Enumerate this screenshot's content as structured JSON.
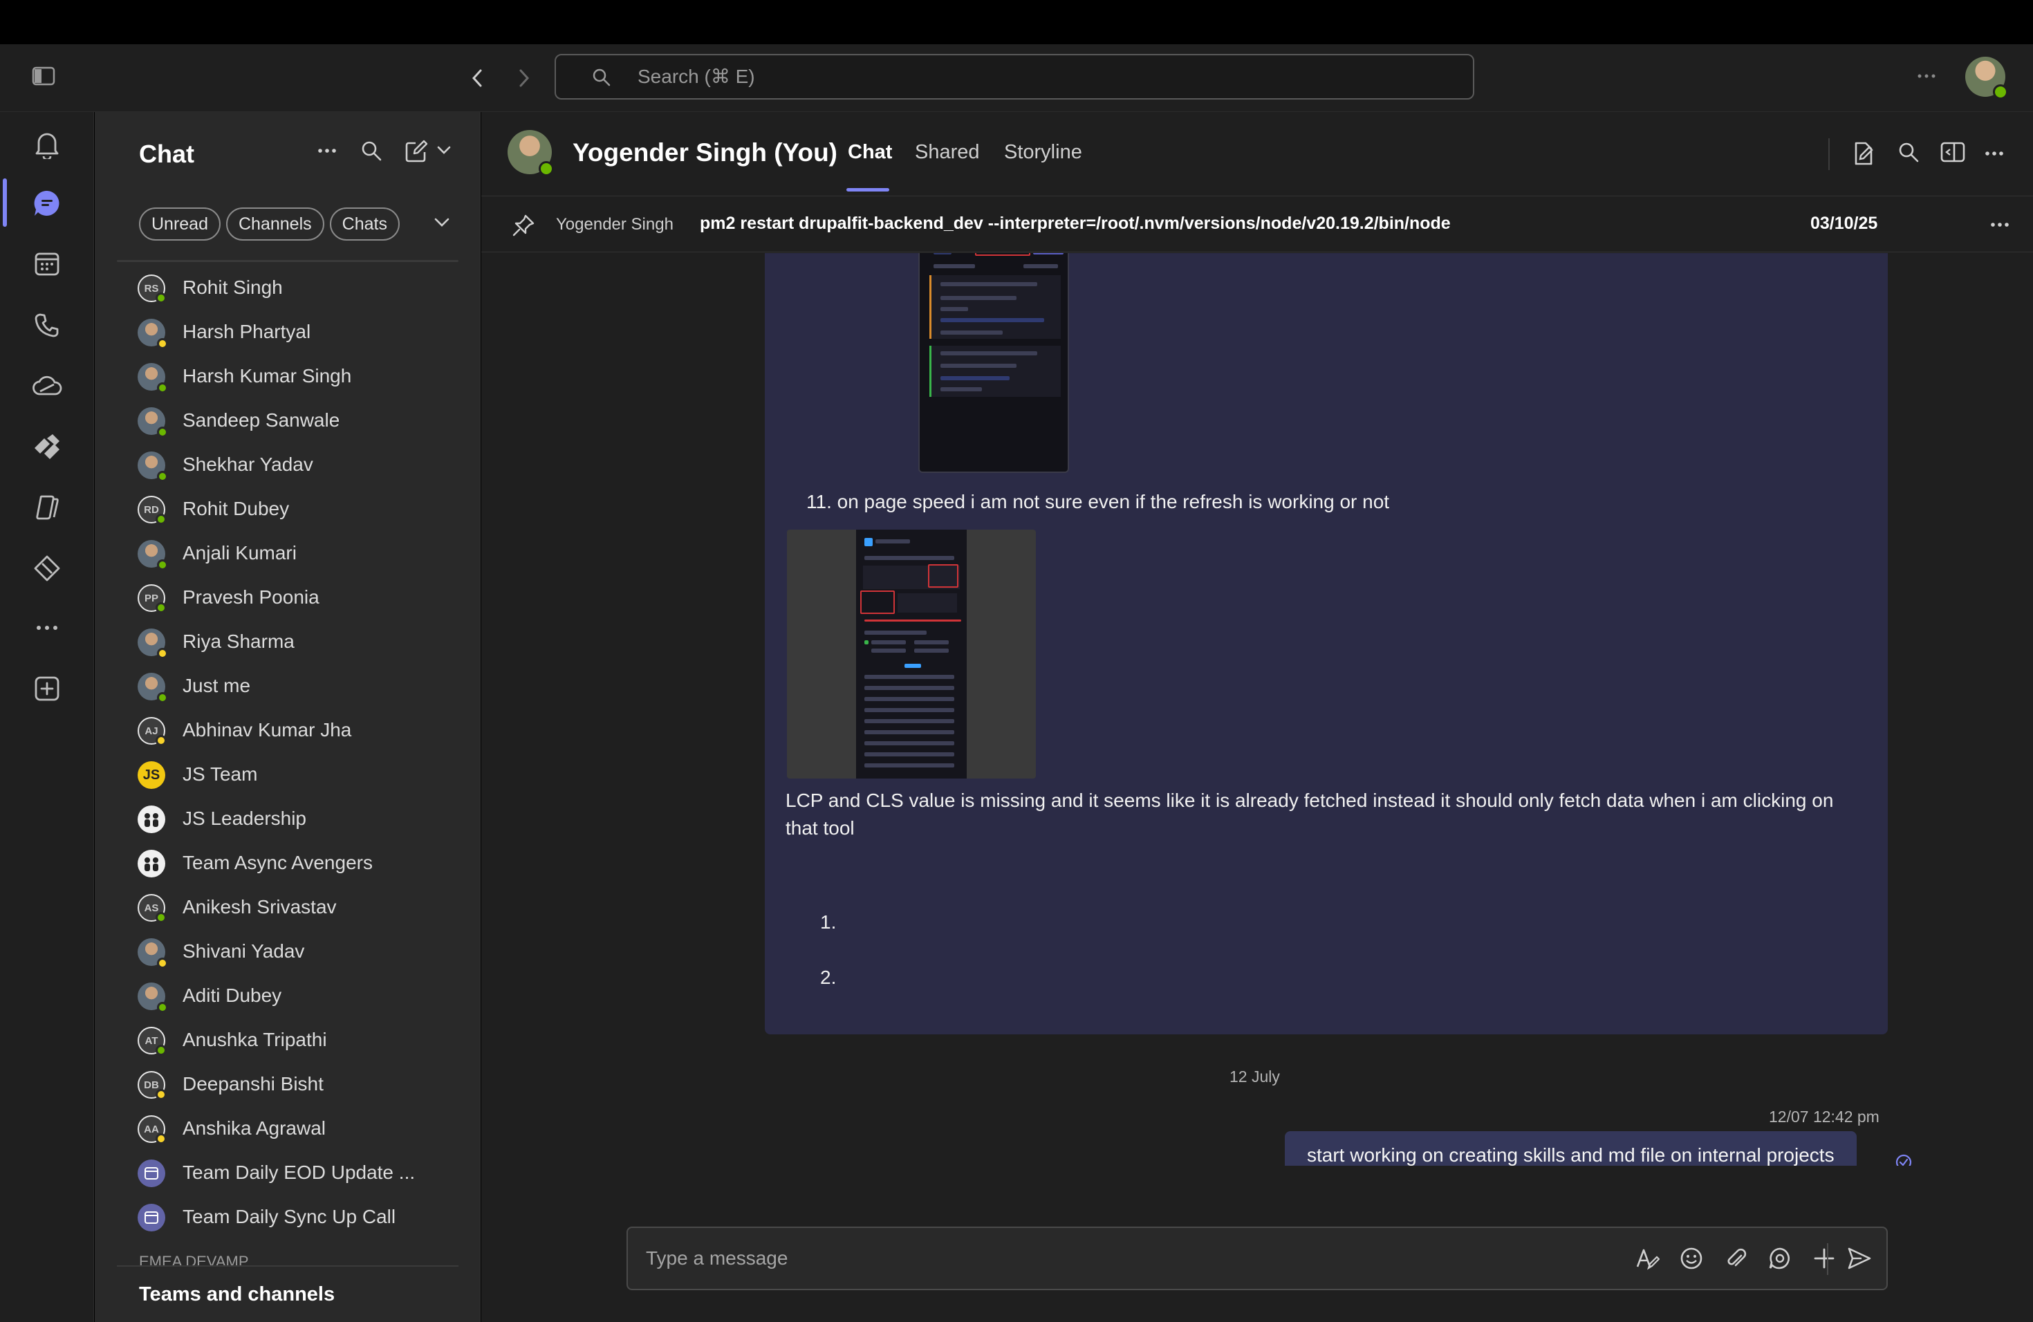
{
  "topbar": {
    "search_placeholder": "Search (⌘ E)"
  },
  "chat_panel": {
    "title": "Chat",
    "filters": [
      "Unread",
      "Channels",
      "Chats"
    ],
    "items": [
      {
        "name": "Rohit Singh",
        "initials": "RS",
        "avatar": "init",
        "status": "#6bb700"
      },
      {
        "name": "Harsh Phartyal",
        "initials": "",
        "avatar": "photo",
        "status": "#f8d22a"
      },
      {
        "name": "Harsh Kumar Singh",
        "initials": "",
        "avatar": "photo",
        "status": "#6bb700"
      },
      {
        "name": "Sandeep Sanwale",
        "initials": "",
        "avatar": "photo",
        "status": "#6bb700"
      },
      {
        "name": "Shekhar Yadav",
        "initials": "",
        "avatar": "photo",
        "status": "#6bb700"
      },
      {
        "name": "Rohit Dubey",
        "initials": "RD",
        "avatar": "init",
        "status": "#6bb700"
      },
      {
        "name": "Anjali Kumari",
        "initials": "",
        "avatar": "photo",
        "status": "#6bb700"
      },
      {
        "name": "Pravesh Poonia",
        "initials": "PP",
        "avatar": "init",
        "status": "#6bb700"
      },
      {
        "name": "Riya Sharma",
        "initials": "",
        "avatar": "photo",
        "status": "#f8d22a"
      },
      {
        "name": "Just me",
        "initials": "",
        "avatar": "photo",
        "status": "#6bb700"
      },
      {
        "name": "Abhinav Kumar Jha",
        "initials": "AJ",
        "avatar": "init",
        "status": "#f8d22a"
      },
      {
        "name": "JS Team",
        "initials": "JS",
        "avatar": "js",
        "status": ""
      },
      {
        "name": "JS Leadership",
        "initials": "",
        "avatar": "group",
        "status": ""
      },
      {
        "name": "Team Async Avengers",
        "initials": "",
        "avatar": "group",
        "status": ""
      },
      {
        "name": "Anikesh Srivastav",
        "initials": "AS",
        "avatar": "init",
        "status": "#6bb700"
      },
      {
        "name": "Shivani Yadav",
        "initials": "",
        "avatar": "photo",
        "status": "#f8d22a"
      },
      {
        "name": "Aditi Dubey",
        "initials": "",
        "avatar": "photo",
        "status": "#6bb700"
      },
      {
        "name": "Anushka Tripathi",
        "initials": "AT",
        "avatar": "init",
        "status": "#6bb700"
      },
      {
        "name": "Deepanshi Bisht",
        "initials": "DB",
        "avatar": "init",
        "status": "#f8d22a"
      },
      {
        "name": "Anshika Agrawal",
        "initials": "AA",
        "avatar": "init",
        "status": "#f8d22a"
      },
      {
        "name": "Team Daily EOD Update ...",
        "initials": "",
        "avatar": "team",
        "status": ""
      },
      {
        "name": "Team Daily Sync Up Call",
        "initials": "",
        "avatar": "team",
        "status": ""
      }
    ],
    "cut_label": "EMEA DEVAMP",
    "teams_channels": "Teams and channels"
  },
  "conversation": {
    "title": "Yogender Singh (You)",
    "tabs": [
      "Chat",
      "Shared",
      "Storyline"
    ],
    "pinned": {
      "author": "Yogender Singh",
      "text": "pm2 restart drupalfit-backend_dev --interpreter=/root/.nvm/versions/node/v20.19.2/bin/node",
      "date": "03/10/25"
    },
    "messages": {
      "item11": "11. on page speed i am not sure even if the refresh is working or not",
      "lcp": "LCP and CLS value is missing and it seems like it is already fetched instead it should only fetch data when i am clicking on that tool",
      "list_1": "1.",
      "list_2": "2."
    },
    "day_divider": "12 July",
    "my_message": {
      "time": "12/07 12:42 pm",
      "text": "start working on creating  skills and md file on internal projects"
    },
    "composer_placeholder": "Type a message"
  },
  "colors": {
    "accent": "#7f85f5",
    "available": "#6bb700",
    "away": "#f8d22a"
  }
}
